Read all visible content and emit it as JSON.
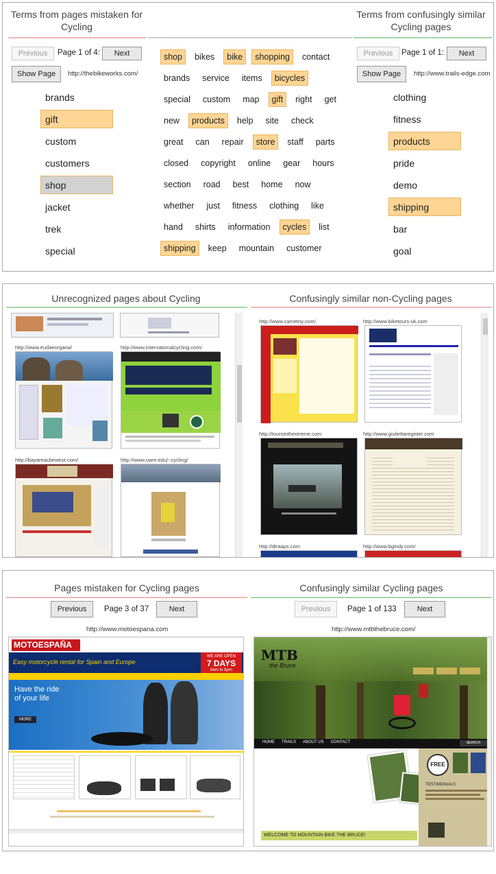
{
  "panel1": {
    "left_title": "Terms from pages mistaken for Cycling",
    "right_title": "Terms from confusingly similar Cycling pages",
    "left_nav": {
      "prev": "Previous",
      "page": "Page 1 of 4:",
      "next": "Next",
      "show": "Show Page",
      "url": "http://thebikeworks.com/"
    },
    "right_nav": {
      "prev": "Previous",
      "page": "Page 1 of 1:",
      "next": "Next",
      "show": "Show Page",
      "url": "http://www.trails-edge.com"
    },
    "left_terms": [
      {
        "t": "brands",
        "s": ""
      },
      {
        "t": "gift",
        "s": "hl"
      },
      {
        "t": "custom",
        "s": ""
      },
      {
        "t": "customers",
        "s": ""
      },
      {
        "t": "shop",
        "s": "sel"
      },
      {
        "t": "jacket",
        "s": ""
      },
      {
        "t": "trek",
        "s": ""
      },
      {
        "t": "special",
        "s": ""
      }
    ],
    "right_terms": [
      {
        "t": "clothing",
        "s": ""
      },
      {
        "t": "fitness",
        "s": ""
      },
      {
        "t": "products",
        "s": "hl"
      },
      {
        "t": "pride",
        "s": ""
      },
      {
        "t": "demo",
        "s": ""
      },
      {
        "t": "shipping",
        "s": "hl"
      },
      {
        "t": "bar",
        "s": ""
      },
      {
        "t": "goal",
        "s": ""
      }
    ],
    "cloud": [
      [
        {
          "t": "shop",
          "s": "hl"
        },
        {
          "t": "bikes",
          "s": ""
        },
        {
          "t": "bike",
          "s": "hl"
        },
        {
          "t": "shopping",
          "s": "hl"
        },
        {
          "t": "contact",
          "s": ""
        }
      ],
      [
        {
          "t": "brands",
          "s": ""
        },
        {
          "t": "service",
          "s": ""
        },
        {
          "t": "items",
          "s": ""
        },
        {
          "t": "bicycles",
          "s": "hl"
        }
      ],
      [
        {
          "t": "special",
          "s": ""
        },
        {
          "t": "custom",
          "s": ""
        },
        {
          "t": "map",
          "s": ""
        },
        {
          "t": "gift",
          "s": "hl"
        },
        {
          "t": "right",
          "s": ""
        },
        {
          "t": "get",
          "s": ""
        }
      ],
      [
        {
          "t": "new",
          "s": ""
        },
        {
          "t": "products",
          "s": "hl"
        },
        {
          "t": "help",
          "s": ""
        },
        {
          "t": "site",
          "s": ""
        },
        {
          "t": "check",
          "s": ""
        }
      ],
      [
        {
          "t": "great",
          "s": ""
        },
        {
          "t": "can",
          "s": ""
        },
        {
          "t": "repair",
          "s": ""
        },
        {
          "t": "store",
          "s": "hl"
        },
        {
          "t": "staff",
          "s": ""
        },
        {
          "t": "parts",
          "s": ""
        }
      ],
      [
        {
          "t": "closed",
          "s": ""
        },
        {
          "t": "copyright",
          "s": ""
        },
        {
          "t": "online",
          "s": ""
        },
        {
          "t": "gear",
          "s": ""
        },
        {
          "t": "hours",
          "s": ""
        }
      ],
      [
        {
          "t": "section",
          "s": ""
        },
        {
          "t": "road",
          "s": ""
        },
        {
          "t": "best",
          "s": ""
        },
        {
          "t": "home",
          "s": ""
        },
        {
          "t": "now",
          "s": ""
        }
      ],
      [
        {
          "t": "whether",
          "s": ""
        },
        {
          "t": "just",
          "s": ""
        },
        {
          "t": "fitness",
          "s": ""
        },
        {
          "t": "clothing",
          "s": ""
        },
        {
          "t": "like",
          "s": ""
        }
      ],
      [
        {
          "t": "hand",
          "s": ""
        },
        {
          "t": "shirts",
          "s": ""
        },
        {
          "t": "information",
          "s": ""
        },
        {
          "t": "cycles",
          "s": "hl"
        },
        {
          "t": "list",
          "s": ""
        }
      ],
      [
        {
          "t": "shipping",
          "s": "hl"
        },
        {
          "t": "keep",
          "s": ""
        },
        {
          "t": "mountain",
          "s": ""
        },
        {
          "t": "customer",
          "s": ""
        }
      ]
    ]
  },
  "panel2": {
    "left_title": "Unrecognized pages about Cycling",
    "right_title": "Confusingly similar non-Cycling pages",
    "left_urls": [
      "http://www.eudaeorgana/",
      "http://www.internationalcycling.com/",
      "http://bayareacbewirot.com/",
      "http://www.uwm.edu/~cycling/"
    ],
    "right_urls": [
      "http://www.cametny.com/",
      "http://www.biketours-uk.com",
      "http://tourstnthextreme.com",
      "http://www.giuliettaregister.com",
      "http://dtraaps.com",
      "http://www.bgindy.com/"
    ]
  },
  "panel3": {
    "left_title": "Pages mistaken for Cycling pages",
    "right_title": "Confusingly similar Cycling pages",
    "left_nav": {
      "prev": "Previous",
      "page": "Page 3 of 37",
      "next": "Next",
      "url": "http://www.motoespana.com"
    },
    "right_nav": {
      "prev": "Previous",
      "page": "Page 1 of 133",
      "next": "Next",
      "url": "http://www.mtbthebruce.com/"
    },
    "moto": {
      "logo": "MOTOESPAÑA",
      "tagline": "Easy motorcycle rental for Spain and Europe",
      "badge1": "WE ARE OPEN",
      "badge2": "7 DAYS",
      "badge3": "8am to 8pm",
      "hero1": "Have the ride",
      "hero2": "of your life",
      "more": "MORE"
    },
    "mtb": {
      "logo1": "MTB",
      "logo2": "the Bruce",
      "menu": [
        "HOME",
        "TRAILS",
        "ABOUT US",
        "CONTACT"
      ],
      "search": "SEARCH",
      "welcome": "WELCOME TO MOUNTAIN BIKE THE BRUCE!",
      "free": "FREE",
      "testimonials": "TESTIMONIALS"
    }
  },
  "colors": {
    "highlight": "#fdd594",
    "highlight_border": "#eab460",
    "red_rule": "#f0b8b8",
    "green_rule": "#a6d8a6"
  }
}
